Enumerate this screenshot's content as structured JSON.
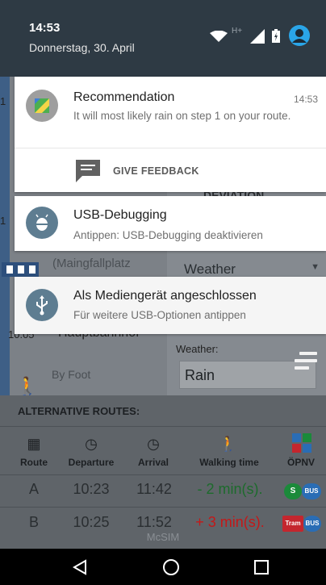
{
  "status_bar": {
    "time": "14:53",
    "date": "Donnerstag, 30. April",
    "network_type": "H+",
    "icons": [
      "wifi-icon",
      "cellular-signal-icon",
      "battery-icon",
      "account-icon"
    ]
  },
  "notifications": [
    {
      "app_icon": "map-icon",
      "title": "Recommendation",
      "text": "It will most likely rain on step 1 on your route.",
      "time": "14:53",
      "action_icon": "feedback-icon",
      "action_label": "GIVE FEEDBACK"
    },
    {
      "app_icon": "android-debug-icon",
      "title": "USB-Debugging",
      "text": "Antippen: USB-Debugging deaktivieren"
    },
    {
      "app_icon": "usb-icon",
      "title": "Als Mediengerät angeschlossen",
      "text": "Für weitere USB-Optionen antippen"
    }
  ],
  "background_app": {
    "stop_name": "(Maingfallplatz",
    "station_name": "Hauptbahnhof",
    "station_time": "10:05",
    "mode_text": "By Foot",
    "deviation_label": "DEVIATION",
    "select_value": "Weather",
    "weather_label": "Weather:",
    "weather_value": "Rain",
    "alt_routes_title": "ALTERNATIVE ROUTES:",
    "headers": [
      "Route",
      "Departure",
      "Arrival",
      "Walking time",
      "ÖPNV"
    ],
    "header_icons": [
      "map-book-icon",
      "clock-icon",
      "clock-icon",
      "walking-person-icon",
      "transit-logo-icon"
    ],
    "rows": [
      {
        "route": "A",
        "departure": "10:23",
        "arrival": "11:42",
        "walking": "- 2 min(s).",
        "walking_color": "#1d6b2c",
        "badges": [
          "S",
          "BUS"
        ]
      },
      {
        "route": "B",
        "departure": "10:25",
        "arrival": "11:52",
        "walking": "+ 3 min(s).",
        "walking_color": "#c41818",
        "badges": [
          "Tram",
          "BUS"
        ]
      }
    ],
    "footer": "McSIM"
  },
  "colors": {
    "shade_header": "#2e3a44",
    "notification_bg": "#ffffff",
    "usb_card_bg": "#f5f5f5",
    "recommendation_icon_bg": "#9e9e9e",
    "system_icon_bg": "#5e7d91",
    "account_icon": "#2aa5e8"
  },
  "nav": {
    "icons": [
      "back-icon",
      "home-icon",
      "recents-icon"
    ]
  }
}
